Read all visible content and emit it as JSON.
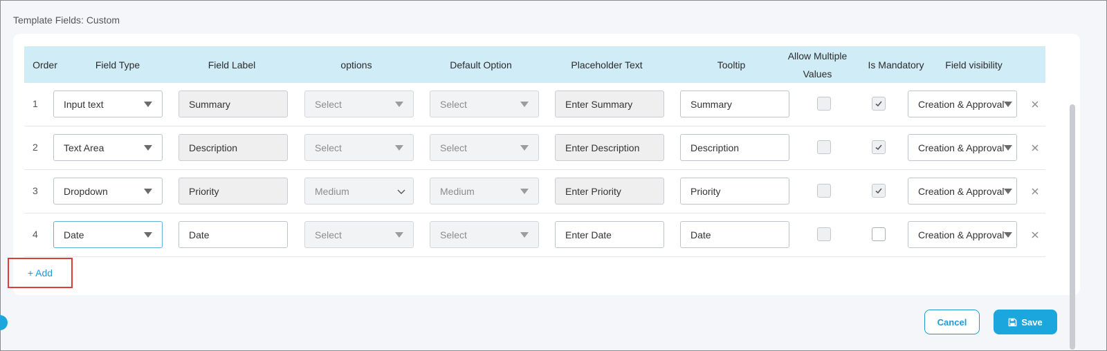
{
  "section": {
    "title": "Template Fields: Custom"
  },
  "headers": {
    "order": "Order",
    "field_type": "Field Type",
    "field_label": "Field Label",
    "options": "options",
    "default_option": "Default Option",
    "placeholder_text": "Placeholder Text",
    "tooltip": "Tooltip",
    "allow_multiple_line1": "Allow Multiple",
    "allow_multiple_line2": "Values",
    "is_mandatory": "Is Mandatory",
    "field_visibility": "Field visibility"
  },
  "rows": [
    {
      "order": "1",
      "field_type": "Input text",
      "field_label": "Summary",
      "options": "Select",
      "default_option": "Select",
      "placeholder": "Enter Summary",
      "tooltip": "Summary",
      "allow_multiple": false,
      "mandatory": true,
      "visibility": "Creation & Approval"
    },
    {
      "order": "2",
      "field_type": "Text Area",
      "field_label": "Description",
      "options": "Select",
      "default_option": "Select",
      "placeholder": "Enter Description",
      "tooltip": "Description",
      "allow_multiple": false,
      "mandatory": true,
      "visibility": "Creation & Approval"
    },
    {
      "order": "3",
      "field_type": "Dropdown",
      "field_label": "Priority",
      "options": "Medium",
      "default_option": "Medium",
      "placeholder": "Enter Priority",
      "tooltip": "Priority",
      "allow_multiple": false,
      "mandatory": true,
      "visibility": "Creation & Approval"
    },
    {
      "order": "4",
      "field_type": "Date",
      "field_label": "Date",
      "options": "Select",
      "default_option": "Select",
      "placeholder": "Enter Date",
      "tooltip": "Date",
      "allow_multiple": false,
      "mandatory": false,
      "visibility": "Creation & Approval"
    }
  ],
  "actions": {
    "add_label": "+ Add",
    "cancel_label": "Cancel",
    "save_label": "Save"
  },
  "colors": {
    "accent": "#1ca6de",
    "header_bg": "#cfecf7",
    "highlight_border": "#e03a3a"
  }
}
